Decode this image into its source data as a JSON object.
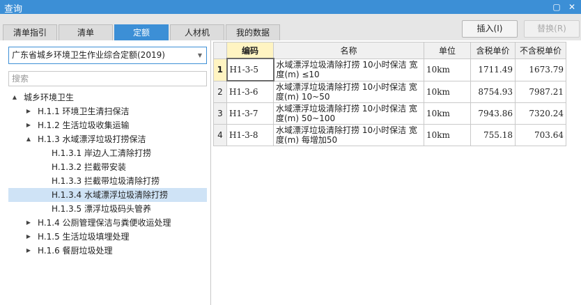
{
  "window": {
    "title": "查询",
    "maximize_icon": "maximize-icon",
    "close_icon": "close-icon"
  },
  "tabs": [
    {
      "label": "清单指引",
      "active": false
    },
    {
      "label": "清单",
      "active": false
    },
    {
      "label": "定额",
      "active": true
    },
    {
      "label": "人材机",
      "active": false
    },
    {
      "label": "我的数据",
      "active": false
    }
  ],
  "toolbar": {
    "insert_label": "插入(I)",
    "replace_label": "替换(R)"
  },
  "left": {
    "dropdown_value": "广东省城乡环境卫生作业综合定额(2019)",
    "search_placeholder": "搜索",
    "tree": [
      {
        "label": "城乡环境卫生",
        "level": 0,
        "arrow": "▲"
      },
      {
        "label": "H.1.1 环境卫生清扫保洁",
        "level": 1,
        "arrow": "▶"
      },
      {
        "label": "H.1.2 生活垃圾收集运输",
        "level": 1,
        "arrow": "▶"
      },
      {
        "label": "H.1.3 水域漂浮垃圾打捞保洁",
        "level": 1,
        "arrow": "▲"
      },
      {
        "label": "H.1.3.1 岸边人工清除打捞",
        "level": 2,
        "arrow": ""
      },
      {
        "label": "H.1.3.2 拦截带安装",
        "level": 2,
        "arrow": ""
      },
      {
        "label": "H.1.3.3 拦截带垃圾清除打捞",
        "level": 2,
        "arrow": ""
      },
      {
        "label": "H.1.3.4 水域漂浮垃圾清除打捞",
        "level": 2,
        "arrow": "",
        "selected": true
      },
      {
        "label": "H.1.3.5 漂浮垃圾码头管养",
        "level": 2,
        "arrow": ""
      },
      {
        "label": "H.1.4 公厕管理保洁与粪便收运处理",
        "level": 1,
        "arrow": "▶"
      },
      {
        "label": "H.1.5 生活垃圾填埋处理",
        "level": 1,
        "arrow": "▶"
      },
      {
        "label": "H.1.6 餐厨垃圾处理",
        "level": 1,
        "arrow": "▶"
      }
    ]
  },
  "grid": {
    "headers": {
      "rownum": "",
      "code": "编码",
      "name": "名称",
      "unit": "单位",
      "price_tax": "含税单价",
      "price_notax": "不含税单价"
    },
    "rows": [
      {
        "no": "1",
        "code": "H1-3-5",
        "name": "水域漂浮垃圾清除打捞 10小时保洁 宽度(m) ≤10",
        "unit": "10km",
        "price_tax": "1711.49",
        "price_notax": "1673.79"
      },
      {
        "no": "2",
        "code": "H1-3-6",
        "name": "水域漂浮垃圾清除打捞 10小时保洁 宽度(m) 10~50",
        "unit": "10km",
        "price_tax": "8754.93",
        "price_notax": "7987.21"
      },
      {
        "no": "3",
        "code": "H1-3-7",
        "name": "水域漂浮垃圾清除打捞 10小时保洁 宽度(m) 50~100",
        "unit": "10km",
        "price_tax": "7943.86",
        "price_notax": "7320.24"
      },
      {
        "no": "4",
        "code": "H1-3-8",
        "name": "水域漂浮垃圾清除打捞 10小时保洁 宽度(m) 每增加50",
        "unit": "10km",
        "price_tax": "755.18",
        "price_notax": "703.64"
      }
    ]
  },
  "colors": {
    "accent": "#3c8fd6",
    "selected_row": "#cfe3f6",
    "header_highlight": "#fff4c2"
  }
}
